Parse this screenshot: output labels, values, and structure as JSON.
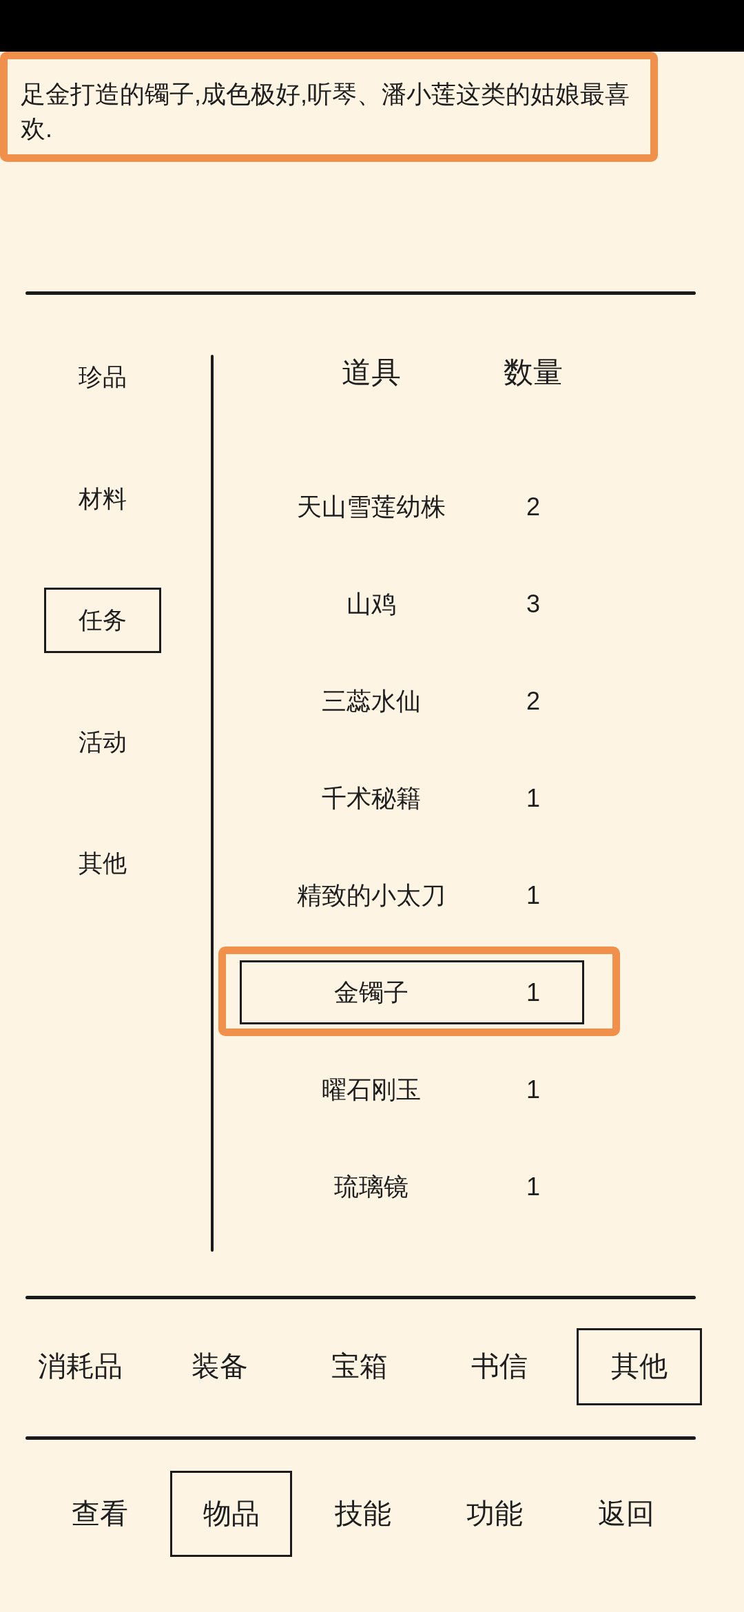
{
  "description": {
    "text": "足金打造的镯子,成色极好,听琴、潘小莲这类的姑娘最喜欢."
  },
  "sidebar": {
    "items": [
      {
        "label": "珍品",
        "selected": false
      },
      {
        "label": "材料",
        "selected": false
      },
      {
        "label": "任务",
        "selected": true
      },
      {
        "label": "活动",
        "selected": false
      },
      {
        "label": "其他",
        "selected": false
      }
    ]
  },
  "table": {
    "columns": [
      "道具",
      "数量"
    ],
    "rows": [
      {
        "name": "天山雪莲幼株",
        "count": "2",
        "selected": false
      },
      {
        "name": "山鸡",
        "count": "3",
        "selected": false
      },
      {
        "name": "三蕊水仙",
        "count": "2",
        "selected": false
      },
      {
        "name": "千术秘籍",
        "count": "1",
        "selected": false
      },
      {
        "name": "精致的小太刀",
        "count": "1",
        "selected": false
      },
      {
        "name": "金镯子",
        "count": "1",
        "selected": true
      },
      {
        "name": "曜石刚玉",
        "count": "1",
        "selected": false
      },
      {
        "name": "琉璃镜",
        "count": "1",
        "selected": false
      }
    ]
  },
  "category_tabs": [
    {
      "label": "消耗品",
      "selected": false
    },
    {
      "label": "装备",
      "selected": false
    },
    {
      "label": "宝箱",
      "selected": false
    },
    {
      "label": "书信",
      "selected": false
    },
    {
      "label": "其他",
      "selected": true
    }
  ],
  "bottom_nav": [
    {
      "label": "查看",
      "selected": false
    },
    {
      "label": "物品",
      "selected": true
    },
    {
      "label": "技能",
      "selected": false
    },
    {
      "label": "功能",
      "selected": false
    },
    {
      "label": "返回",
      "selected": false
    }
  ]
}
